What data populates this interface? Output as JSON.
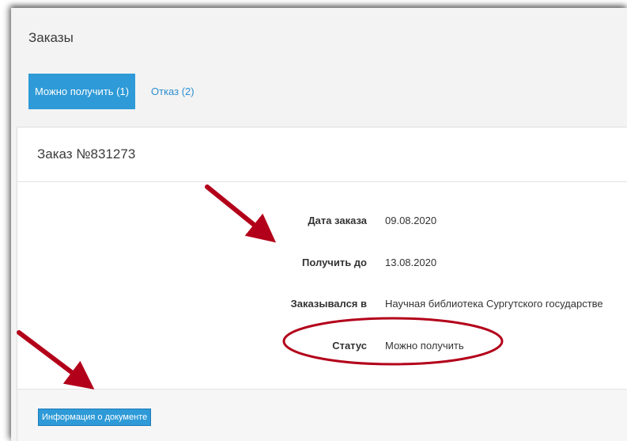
{
  "page": {
    "title": "Заказы"
  },
  "tabs": [
    {
      "label": "Можно получить (1)",
      "active": true
    },
    {
      "label": "Отказ (2)",
      "active": false
    }
  ],
  "order": {
    "title": "Заказ №831273",
    "fields": [
      {
        "label": "Дата заказа",
        "value": "09.08.2020"
      },
      {
        "label": "Получить до",
        "value": "13.08.2020"
      },
      {
        "label": "Заказывался в",
        "value": "Научная библиотека Сургутского государстве"
      },
      {
        "label": "Статус",
        "value": "Можно получить"
      }
    ],
    "doc_button": "Информация о документе"
  },
  "colors": {
    "accent": "#2e9ad7",
    "annotation": "#b3001a"
  }
}
